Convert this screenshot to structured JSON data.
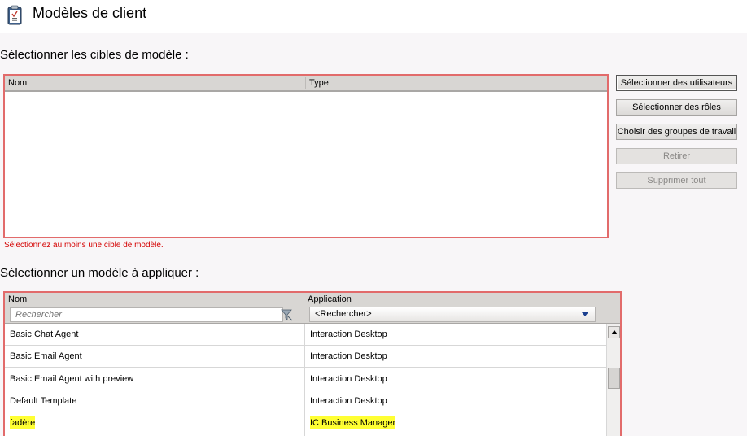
{
  "window": {
    "title": "Modèles de client"
  },
  "targets": {
    "section_label": "Sélectionner les cibles de modèle :",
    "columns": [
      "Nom",
      "Type"
    ],
    "validation_message": "Sélectionnez au moins une cible de modèle."
  },
  "buttons": {
    "select_users": "Sélectionner des utilisateurs",
    "select_roles": "Sélectionner des rôles",
    "choose_workgroups": "Choisir des groupes de travail",
    "remove": "Retirer",
    "remove_all": "Supprimer tout"
  },
  "templates": {
    "section_label": "Sélectionner un modèle à appliquer :",
    "columns": [
      "Nom",
      "Application"
    ],
    "search_placeholder": "Rechercher",
    "application_filter": "<Rechercher>",
    "rows": [
      {
        "name": "Basic Chat Agent",
        "application": "Interaction Desktop",
        "highlighted": false
      },
      {
        "name": "Basic Email Agent",
        "application": "Interaction Desktop",
        "highlighted": false
      },
      {
        "name": "Basic Email Agent with preview",
        "application": "Interaction Desktop",
        "highlighted": false
      },
      {
        "name": "Default Template",
        "application": "Interaction Desktop",
        "highlighted": false
      },
      {
        "name": "fadère",
        "application": "IC Business Manager",
        "highlighted": true
      }
    ]
  },
  "colors": {
    "panel_border": "#e26b6b",
    "validation_text": "#d40000",
    "highlight": "#ffff33"
  }
}
